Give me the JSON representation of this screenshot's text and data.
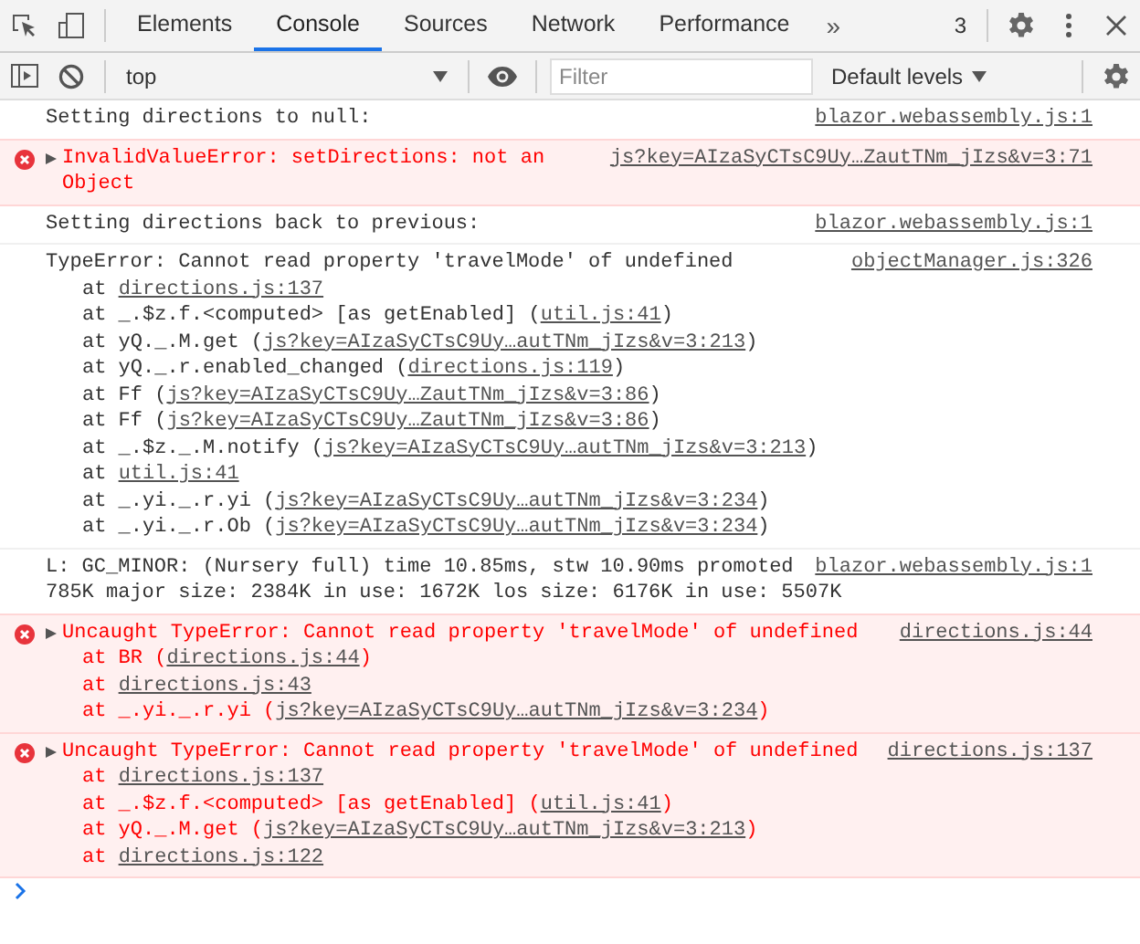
{
  "tabs": [
    {
      "label": "Elements",
      "selected": false
    },
    {
      "label": "Console",
      "selected": true
    },
    {
      "label": "Sources",
      "selected": false
    },
    {
      "label": "Network",
      "selected": false
    },
    {
      "label": "Performance",
      "selected": false
    }
  ],
  "more_tabs": "»",
  "error_count": "3",
  "console_toolbar": {
    "context": "top",
    "filter": {
      "placeholder": "Filter"
    },
    "levels": "Default levels"
  },
  "messages": [
    {
      "kind": "log",
      "lines": [
        "Setting directions to null:"
      ],
      "source": "blazor.webassembly.js:1"
    },
    {
      "kind": "error",
      "expanded": false,
      "lines": [
        "InvalidValueError: setDirections: not an Object"
      ],
      "source": "js?key=AIzaSyCTsC9Uy…ZautTNm_jIzs&v=3:71"
    },
    {
      "kind": "log",
      "lines": [
        "Setting directions back to previous:"
      ],
      "source": "blazor.webassembly.js:1"
    },
    {
      "kind": "log",
      "lines": [
        "TypeError: Cannot read property 'travelMode' of undefined"
      ],
      "source": "objectManager.js:326",
      "stack": [
        {
          "before": "at ",
          "link": "directions.js:137"
        },
        {
          "before": "at _.$z.f.<computed> [as getEnabled] (",
          "link": "util.js:41",
          "after": ")"
        },
        {
          "before": "at yQ._.M.get (",
          "link": "js?key=AIzaSyCTsC9Uy…autTNm_jIzs&v=3:213",
          "after": ")"
        },
        {
          "before": "at yQ._.r.enabled_changed (",
          "link": "directions.js:119",
          "after": ")"
        },
        {
          "before": "at Ff (",
          "link": "js?key=AIzaSyCTsC9Uy…ZautTNm_jIzs&v=3:86",
          "after": ")"
        },
        {
          "before": "at Ff (",
          "link": "js?key=AIzaSyCTsC9Uy…ZautTNm_jIzs&v=3:86",
          "after": ")"
        },
        {
          "before": "at _.$z._.M.notify (",
          "link": "js?key=AIzaSyCTsC9Uy…autTNm_jIzs&v=3:213",
          "after": ")"
        },
        {
          "before": "at ",
          "link": "util.js:41"
        },
        {
          "before": "at _.yi._.r.yi (",
          "link": "js?key=AIzaSyCTsC9Uy…autTNm_jIzs&v=3:234",
          "after": ")"
        },
        {
          "before": "at _.yi._.r.Ob (",
          "link": "js?key=AIzaSyCTsC9Uy…autTNm_jIzs&v=3:234",
          "after": ")"
        }
      ]
    },
    {
      "kind": "log",
      "lines": [
        "L: GC_MINOR: (Nursery full) time 10.85ms, stw 10.90ms promoted",
        "785K major size: 2384K in use: 1672K los size: 6176K in use: 5507K"
      ],
      "source": "blazor.webassembly.js:1"
    },
    {
      "kind": "error",
      "expanded": false,
      "lines": [
        "Uncaught TypeError: Cannot read property 'travelMode' of undefined"
      ],
      "source": "directions.js:44",
      "stack": [
        {
          "before": "at BR (",
          "link": "directions.js:44",
          "after": ")"
        },
        {
          "before": "at ",
          "link": "directions.js:43"
        },
        {
          "before": "at _.yi._.r.yi (",
          "link": "js?key=AIzaSyCTsC9Uy…autTNm_jIzs&v=3:234",
          "after": ")"
        }
      ]
    },
    {
      "kind": "error",
      "expanded": false,
      "lines": [
        "Uncaught TypeError: Cannot read property 'travelMode' of undefined"
      ],
      "source": "directions.js:137",
      "stack": [
        {
          "before": "at ",
          "link": "directions.js:137"
        },
        {
          "before": "at _.$z.f.<computed> [as getEnabled] (",
          "link": "util.js:41",
          "after": ")"
        },
        {
          "before": "at yQ._.M.get (",
          "link": "js?key=AIzaSyCTsC9Uy…autTNm_jIzs&v=3:213",
          "after": ")"
        },
        {
          "before": "at ",
          "link": "directions.js:122"
        }
      ]
    }
  ]
}
